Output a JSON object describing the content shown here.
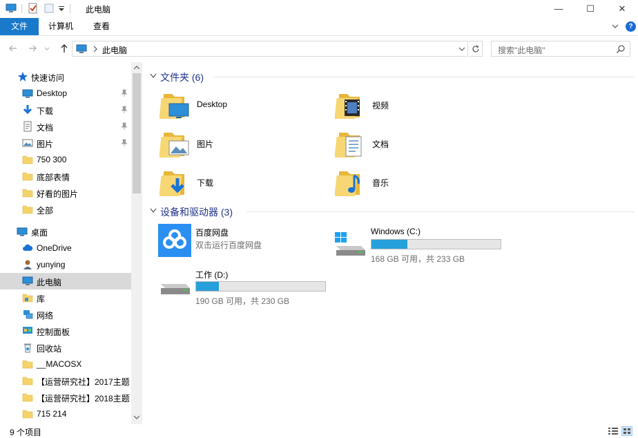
{
  "window": {
    "title": "此电脑",
    "minimize": "—",
    "maximize": "☐",
    "close": "✕"
  },
  "ribbon": {
    "tabs": [
      "文件",
      "计算机",
      "查看"
    ],
    "help": "?"
  },
  "address": {
    "path": "此电脑",
    "search_placeholder": "搜索\"此电脑\""
  },
  "sidebar": {
    "quick_access": "快速访问",
    "items": [
      {
        "label": "Desktop",
        "icon": "desktop-icon",
        "pinned": true
      },
      {
        "label": "下载",
        "icon": "download-icon",
        "pinned": true
      },
      {
        "label": "文档",
        "icon": "document-icon",
        "pinned": true
      },
      {
        "label": "图片",
        "icon": "picture-icon",
        "pinned": true
      },
      {
        "label": "750 300",
        "icon": "folder-icon"
      },
      {
        "label": "底部表情",
        "icon": "folder-icon"
      },
      {
        "label": "好看的图片",
        "icon": "folder-icon"
      },
      {
        "label": "全部",
        "icon": "folder-icon"
      },
      {
        "label": "桌面",
        "icon": "desktop-icon",
        "top": true
      },
      {
        "label": "OneDrive",
        "icon": "cloud-icon"
      },
      {
        "label": "yunying",
        "icon": "user-icon"
      },
      {
        "label": "此电脑",
        "icon": "computer-icon",
        "selected": true
      },
      {
        "label": "库",
        "icon": "library-icon"
      },
      {
        "label": "网络",
        "icon": "network-icon"
      },
      {
        "label": "控制面板",
        "icon": "control-panel-icon"
      },
      {
        "label": "回收站",
        "icon": "recycle-bin-icon"
      },
      {
        "label": "__MACOSX",
        "icon": "folder-icon"
      },
      {
        "label": "【运营研究社】2017主题",
        "icon": "folder-icon"
      },
      {
        "label": "【运营研究社】2018主题",
        "icon": "folder-icon"
      },
      {
        "label": "715 214",
        "icon": "folder-icon"
      }
    ]
  },
  "main": {
    "folders_header": "文件夹 (6)",
    "folders": [
      {
        "name": "Desktop",
        "icon": "desktop-folder-icon"
      },
      {
        "name": "视频",
        "icon": "video-folder-icon"
      },
      {
        "name": "图片",
        "icon": "picture-folder-icon"
      },
      {
        "name": "文档",
        "icon": "document-folder-icon"
      },
      {
        "name": "下载",
        "icon": "download-folder-icon"
      },
      {
        "name": "音乐",
        "icon": "music-folder-icon"
      }
    ],
    "devices_header": "设备和驱动器 (3)",
    "baidu": {
      "name": "百度网盘",
      "sub": "双击运行百度网盘"
    },
    "drives": [
      {
        "name": "Windows (C:)",
        "free": "168 GB 可用，共 233 GB",
        "used_fraction": 0.279
      },
      {
        "name": "工作 (D:)",
        "free": "190 GB 可用，共 230 GB",
        "used_fraction": 0.174
      }
    ]
  },
  "status": {
    "count": "9 个项目"
  },
  "colors": {
    "accent": "#1979ca",
    "folder": "#f5d36a",
    "drive_fill": "#26a0da",
    "selected": "#d9d9d9",
    "header_text": "#1e3287"
  }
}
